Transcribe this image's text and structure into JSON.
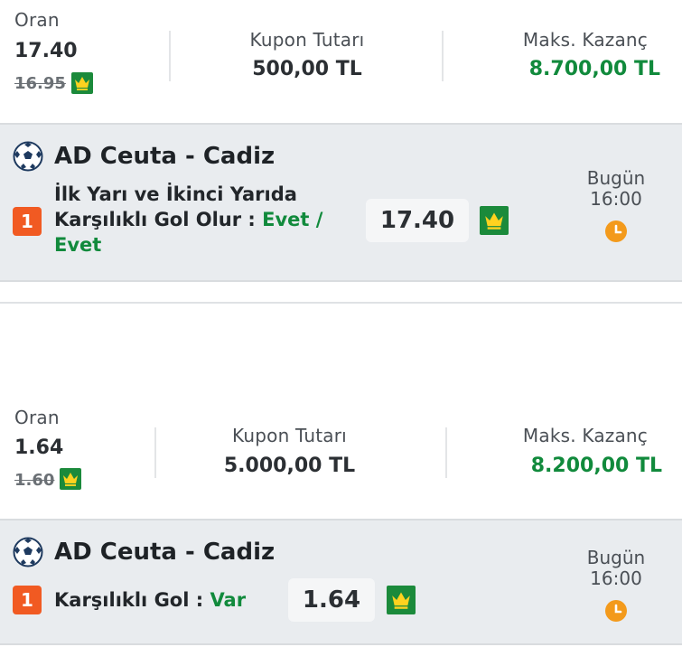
{
  "coupons": [
    {
      "summary": {
        "oran_label": "Oran",
        "oran_value": "17.40",
        "oran_old": "16.95",
        "kupon_label": "Kupon Tutarı",
        "kupon_value": "500,00 TL",
        "maks_label": "Maks. Kazanç",
        "maks_value": "8.700,00 TL"
      },
      "bet": {
        "match": "AD Ceuta - Cadiz",
        "index": "1",
        "market_line1": "İlk Yarı ve İkinci Yarıda",
        "market_line2": "Karşılıklı Gol Olur : ",
        "selection_line2": "Evet /",
        "selection_line3": "Evet",
        "odds": "17.40",
        "day": "Bugün",
        "time": "16:00"
      }
    },
    {
      "summary": {
        "oran_label": "Oran",
        "oran_value": "1.64",
        "oran_old": "1.60",
        "kupon_label": "Kupon Tutarı",
        "kupon_value": "5.000,00 TL",
        "maks_label": "Maks. Kazanç",
        "maks_value": "8.200,00 TL"
      },
      "bet": {
        "match": "AD Ceuta - Cadiz",
        "index": "1",
        "market_line1": "Karşılıklı Gol : ",
        "selection_line1": "Var",
        "odds": "1.64",
        "day": "Bugün",
        "time": "16:00"
      }
    }
  ],
  "icons": {
    "crown": "crown-icon",
    "soccer": "soccer-ball-icon",
    "clock": "clock-icon"
  },
  "colors": {
    "green": "#118a3c",
    "crown_bg": "#1b8a3b",
    "orange": "#f15a22",
    "clock": "#f39a1c",
    "card_bg": "#e9ecef"
  }
}
